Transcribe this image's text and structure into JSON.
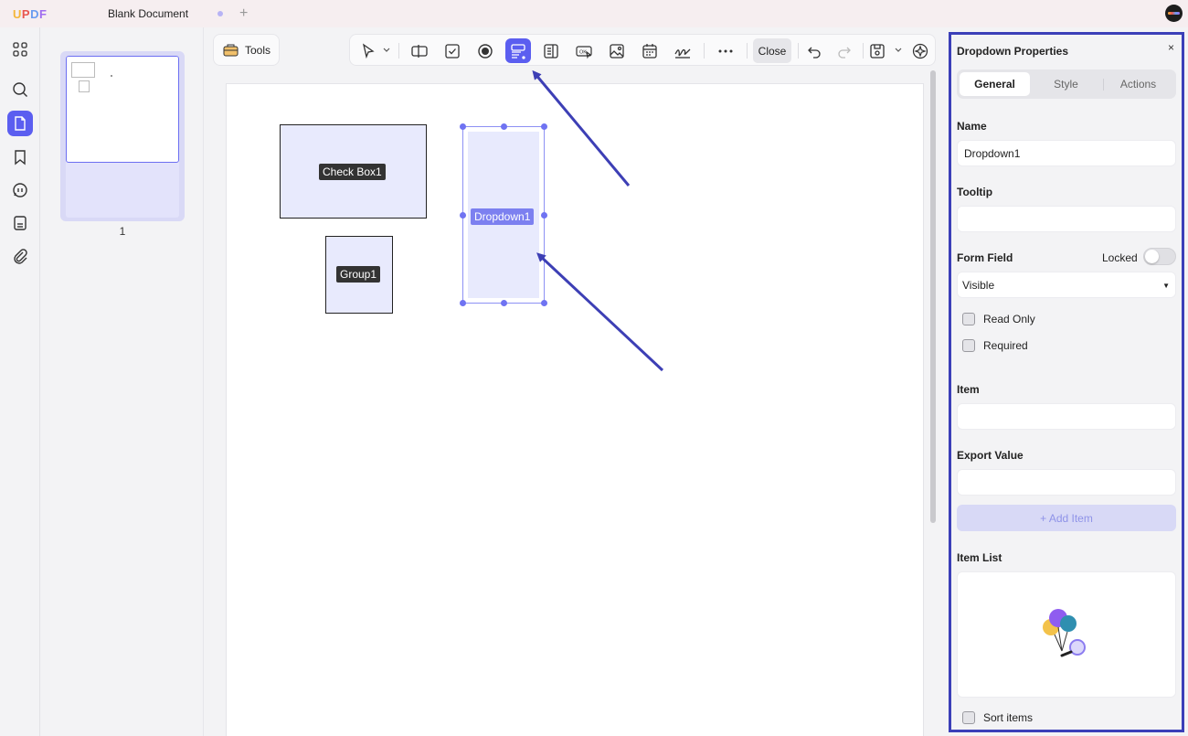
{
  "app": {
    "logo": "UPDF",
    "document_tab": "Blank Document"
  },
  "thumbnails": {
    "page_number": "1"
  },
  "toolbar": {
    "tools_label": "Tools",
    "close_label": "Close"
  },
  "form_fields": [
    {
      "label": "Check Box1"
    },
    {
      "label": "Group1"
    },
    {
      "label": "Dropdown1",
      "selected": true
    }
  ],
  "panel": {
    "title": "Dropdown Properties",
    "close": "×",
    "tabs": [
      "General",
      "Style",
      "Actions"
    ],
    "active_tab": "General",
    "name_label": "Name",
    "name_value": "Dropdown1",
    "tooltip_label": "Tooltip",
    "tooltip_value": "",
    "form_field_label": "Form Field",
    "locked_label": "Locked",
    "locked": false,
    "visibility_value": "Visible",
    "read_only_label": "Read Only",
    "required_label": "Required",
    "item_label": "Item",
    "item_value": "",
    "export_value_label": "Export Value",
    "export_value": "",
    "add_item_label": "+ Add Item",
    "item_list_label": "Item List",
    "sort_items_label": "Sort items"
  },
  "colors": {
    "accent": "#5b5ef0",
    "panel_border": "#3b3fb8",
    "arrow": "#3d3fb5",
    "field_fill": "#e8eafd"
  }
}
